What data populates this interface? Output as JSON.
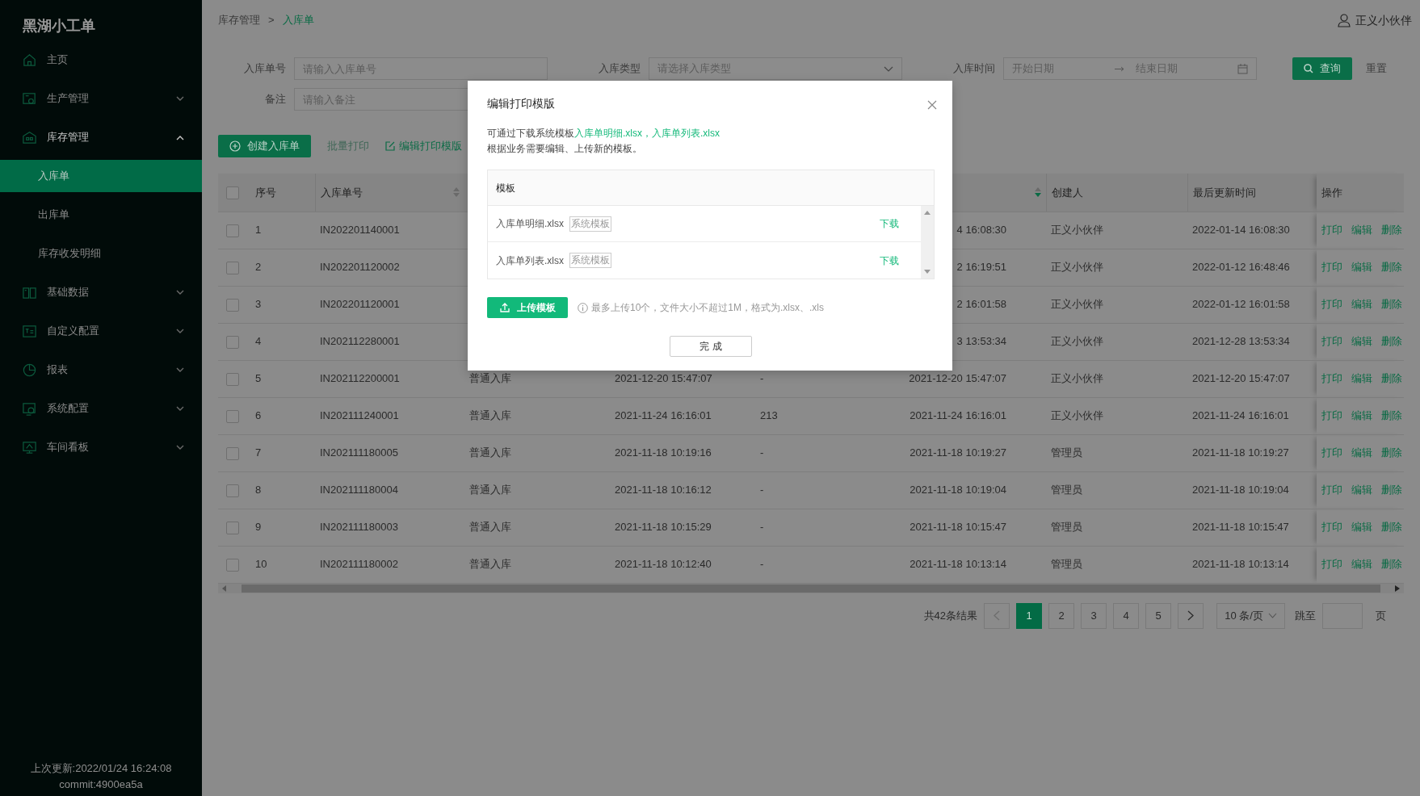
{
  "app": {
    "title": "黑湖小工单"
  },
  "sidebar": {
    "items": [
      {
        "label": "主页",
        "kind": "link",
        "selected": false
      },
      {
        "label": "生产管理",
        "kind": "group",
        "expanded": false
      },
      {
        "label": "库存管理",
        "kind": "group",
        "expanded": true,
        "children": [
          {
            "label": "入库单",
            "selected": true
          },
          {
            "label": "出库单",
            "selected": false
          },
          {
            "label": "库存收发明细",
            "selected": false
          }
        ]
      },
      {
        "label": "基础数据",
        "kind": "group",
        "expanded": false
      },
      {
        "label": "自定义配置",
        "kind": "group",
        "expanded": false
      },
      {
        "label": "报表",
        "kind": "group",
        "expanded": false
      },
      {
        "label": "系统配置",
        "kind": "group",
        "expanded": false
      },
      {
        "label": "车间看板",
        "kind": "group",
        "expanded": false
      }
    ],
    "footer": [
      "上次更新:2022/01/24 16:24:08",
      "commit:4900ea5a"
    ]
  },
  "header": {
    "breadcrumb": [
      {
        "label": "库存管理",
        "selected": false
      },
      {
        "label": "入库单",
        "selected": true
      }
    ],
    "separator": ">",
    "user": "正义小伙伴"
  },
  "filters": [
    {
      "label": "入库单号",
      "kind": "text",
      "placeholder": "请输入入库单号"
    },
    {
      "label": "入库类型",
      "kind": "select",
      "placeholder": "请选择入库类型"
    },
    {
      "label": "入库时间",
      "kind": "daterange",
      "start_placeholder": "开始日期",
      "end_placeholder": "结束日期"
    },
    {
      "label": "备注",
      "kind": "text",
      "placeholder": "请输入备注"
    }
  ],
  "filter_buttons": {
    "search": "查询",
    "reset": "重置"
  },
  "toolbar": [
    {
      "label": "创建入库单",
      "kind": "primary"
    },
    {
      "label": "批量打印",
      "kind": "link",
      "disabled": true
    },
    {
      "label": "编辑打印模版",
      "kind": "link",
      "disabled": false
    }
  ],
  "table": {
    "all_selected": false,
    "columns": [
      {
        "kind": "label",
        "label": "序号"
      },
      {
        "kind": "label",
        "label": "入库单号",
        "sortable": true,
        "descending": false
      },
      {
        "kind": "covered"
      },
      {
        "kind": "covered"
      },
      {
        "kind": "covered"
      },
      {
        "kind": "covered",
        "sortable": true,
        "descending": true
      },
      {
        "kind": "label",
        "label": "创建人"
      },
      {
        "kind": "label",
        "label": "最后更新时间"
      },
      {
        "kind": "label",
        "label": "操作"
      }
    ],
    "rows": [
      {
        "selected": false,
        "index": "1",
        "code": "IN202201140001",
        "created_at": "4 16:08:30",
        "creator": "正义小伙伴",
        "updated_at": "2022-01-14 16:08:30",
        "actions": [
          "打印",
          "编辑",
          "删除"
        ]
      },
      {
        "selected": false,
        "index": "2",
        "code": "IN202201120002",
        "created_at": "2 16:19:51",
        "creator": "正义小伙伴",
        "updated_at": "2022-01-12 16:48:46",
        "actions": [
          "打印",
          "编辑",
          "删除"
        ]
      },
      {
        "selected": false,
        "index": "3",
        "code": "IN202201120001",
        "created_at": "2 16:01:58",
        "creator": "正义小伙伴",
        "updated_at": "2022-01-12 16:01:58",
        "actions": [
          "打印",
          "编辑",
          "删除"
        ]
      },
      {
        "selected": false,
        "index": "4",
        "code": "IN202112280001",
        "created_at": "3 13:53:34",
        "creator": "正义小伙伴",
        "updated_at": "2021-12-28 13:53:34",
        "actions": [
          "打印",
          "编辑",
          "删除"
        ]
      },
      {
        "selected": false,
        "index": "5",
        "code": "IN202112200001",
        "type": "普通入库",
        "in_time": "2021-12-20 15:47:07",
        "remark": "-",
        "created_at": "2021-12-20 15:47:07",
        "creator": "正义小伙伴",
        "updated_at": "2021-12-20 15:47:07",
        "actions": [
          "打印",
          "编辑",
          "删除"
        ]
      },
      {
        "selected": false,
        "index": "6",
        "code": "IN202111240001",
        "type": "普通入库",
        "in_time": "2021-11-24 16:16:01",
        "remark": "213",
        "created_at": "2021-11-24 16:16:01",
        "creator": "正义小伙伴",
        "updated_at": "2021-11-24 16:16:01",
        "actions": [
          "打印",
          "编辑",
          "删除"
        ]
      },
      {
        "selected": false,
        "index": "7",
        "code": "IN202111180005",
        "type": "普通入库",
        "in_time": "2021-11-18 10:19:16",
        "remark": "-",
        "created_at": "2021-11-18 10:19:27",
        "creator": "管理员",
        "updated_at": "2021-11-18 10:19:27",
        "actions": [
          "打印",
          "编辑",
          "删除"
        ]
      },
      {
        "selected": false,
        "index": "8",
        "code": "IN202111180004",
        "type": "普通入库",
        "in_time": "2021-11-18 10:16:12",
        "remark": "-",
        "created_at": "2021-11-18 10:19:04",
        "creator": "管理员",
        "updated_at": "2021-11-18 10:19:04",
        "actions": [
          "打印",
          "编辑",
          "删除"
        ]
      },
      {
        "selected": false,
        "index": "9",
        "code": "IN202111180003",
        "type": "普通入库",
        "in_time": "2021-11-18 10:15:29",
        "remark": "-",
        "created_at": "2021-11-18 10:15:47",
        "creator": "管理员",
        "updated_at": "2021-11-18 10:15:47",
        "actions": [
          "打印",
          "编辑",
          "删除"
        ]
      },
      {
        "selected": false,
        "index": "10",
        "code": "IN202111180002",
        "type": "普通入库",
        "in_time": "2021-11-18 10:12:40",
        "remark": "-",
        "created_at": "2021-11-18 10:13:14",
        "creator": "管理员",
        "updated_at": "2021-11-18 10:13:14",
        "actions": [
          "打印",
          "编辑",
          "删除"
        ]
      }
    ]
  },
  "pagination": {
    "summary": "共42条结果",
    "prev": {
      "disabled": true
    },
    "next": {
      "disabled": false
    },
    "pages": [
      {
        "label": "1",
        "selected": true
      },
      {
        "label": "2",
        "selected": false
      },
      {
        "label": "3",
        "selected": false
      },
      {
        "label": "4",
        "selected": false
      },
      {
        "label": "5",
        "selected": false
      }
    ],
    "page_size": "10 条/页",
    "jump_label": "跳至",
    "jump_unit": "页"
  },
  "modal": {
    "title": "编辑打印模版",
    "intro": "可通过下载系统模板",
    "links": [
      "入库单明细.xlsx",
      "入库单列表.xlsx"
    ],
    "link_separator": "，",
    "note": "根据业务需要编辑、上传新的模板。",
    "template_header": "模板",
    "templates": [
      {
        "name": "入库单明细.xlsx",
        "tag": "系统模板",
        "action": "下载"
      },
      {
        "name": "入库单列表.xlsx",
        "tag": "系统模板",
        "action": "下载"
      }
    ],
    "upload_button": "上传模板",
    "upload_hint": "最多上传10个，文件大小不超过1M，格式为.xlsx、.xls",
    "done_button": "完 成"
  }
}
